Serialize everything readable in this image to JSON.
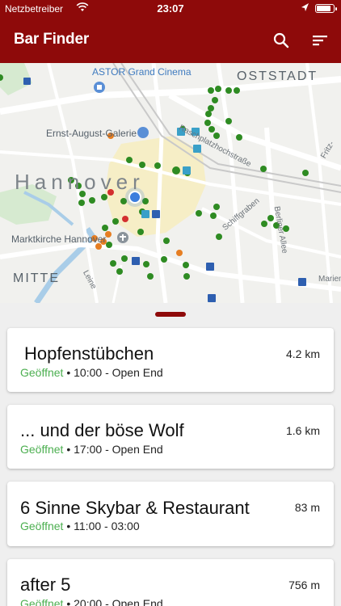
{
  "status_bar": {
    "carrier": "Netzbetreiber",
    "time": "23:07",
    "battery_level": 0.85
  },
  "app_bar": {
    "title": "Bar Finder",
    "search_icon": "search-icon",
    "sort_icon": "sort-icon"
  },
  "map": {
    "labels": {
      "city": "Hannover",
      "oststadt": "OSTSTADT",
      "mitte": "MITTE",
      "astor": "ASTOR Grand Cinema",
      "galerie": "Ernst-August-Galerie",
      "marktkirche": "Marktkirche Hannover",
      "raschplatz": "Raschplatzhochstraße",
      "schiffgraben": "Schiffgraben",
      "berliner_allee": "Berliner Allee",
      "leine": "Leine",
      "fritz": "Fritz-",
      "marien": "Marien"
    },
    "colors": {
      "open": "#2e8b22",
      "closing_soon": "#e67e22",
      "closed": "#d32f2f",
      "user": "#3b7ddd"
    }
  },
  "bars": [
    {
      "name": "Hopfenstübchen",
      "distance": "4.2 km",
      "status": "Geöffnet",
      "hours": "10:00 - Open End"
    },
    {
      "name": "... und der böse Wolf",
      "distance": "1.6 km",
      "status": "Geöffnet",
      "hours": "17:00 - Open End"
    },
    {
      "name": "6 Sinne Skybar & Restaurant",
      "distance": "83 m",
      "status": "Geöffnet",
      "hours": "11:00 - 03:00"
    },
    {
      "name": "after 5",
      "distance": "756 m",
      "status": "Geöffnet",
      "hours": "20:00 - Open End"
    }
  ],
  "separator": "•"
}
